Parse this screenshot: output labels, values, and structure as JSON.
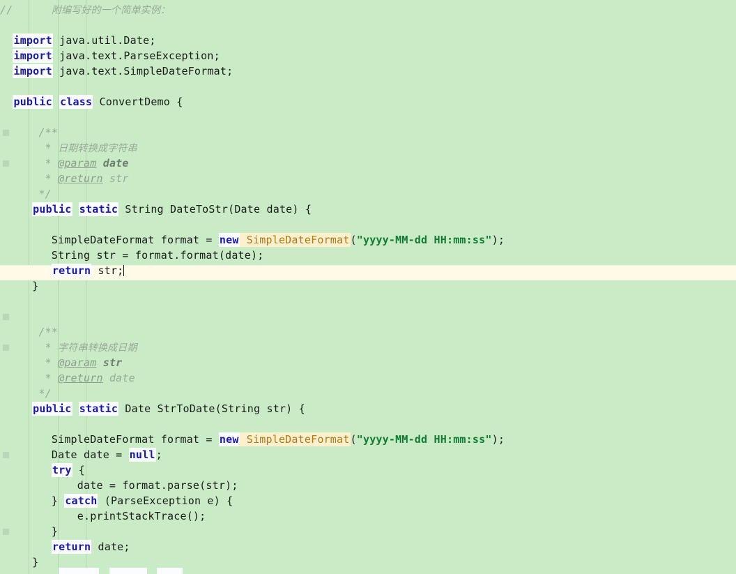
{
  "editor": {
    "language": "Java",
    "background_color": "#c9ecc6",
    "current_line_color": "#fffbe8",
    "keyword_color": "#1818b0",
    "string_color": "#127a32",
    "comment_color": "#9aa89a",
    "class_highlight_color": "#b07818",
    "class_highlight_bg": "#fdf0cd"
  },
  "header": {
    "comment_slashes": "//",
    "comment_text": "附编写好的一个简单实例："
  },
  "code": {
    "imports": [
      {
        "kw": "import",
        "rest": " java.util.Date;"
      },
      {
        "kw": "import",
        "rest": " java.text.ParseException;"
      },
      {
        "kw": "import",
        "rest": " java.text.SimpleDateFormat;"
      }
    ],
    "class_decl": {
      "kw1": "public",
      "kw2": "class",
      "name": " ConvertDemo {"
    },
    "javadoc1": {
      "open": "/**",
      "desc_star": "* ",
      "desc": "日期转换成字符串",
      "param_star": "* ",
      "param_tag": "@param",
      "param_name": " date",
      "return_star": "* ",
      "return_tag": "@return",
      "return_name": " str",
      "close": "*/"
    },
    "method1": {
      "kw1": "public",
      "kw2": "static",
      "sig": " String DateToStr(Date date) {",
      "body_line1_pre": "SimpleDateFormat format = ",
      "body_line1_kw": "new",
      "body_line1_cls": " SimpleDateFormat",
      "body_line1_open": "(",
      "body_line1_str": "\"yyyy-MM-dd HH:mm:ss\"",
      "body_line1_close": ");",
      "body_line2": "String str = format.format(date);",
      "body_line3_kw": "return",
      "body_line3_rest": " str;",
      "close_brace": "}"
    },
    "javadoc2": {
      "open": "/**",
      "desc_star": "* ",
      "desc": "字符串转换成日期",
      "param_star": "* ",
      "param_tag": "@param",
      "param_name": " str",
      "return_star": "* ",
      "return_tag": "@return",
      "return_name": " date",
      "close": "*/"
    },
    "method2": {
      "kw1": "public",
      "kw2": "static",
      "sig": " Date StrToDate(String str) {",
      "body_line1_pre": "SimpleDateFormat format = ",
      "body_line1_kw": "new",
      "body_line1_cls": " SimpleDateFormat",
      "body_line1_open": "(",
      "body_line1_str": "\"yyyy-MM-dd HH:mm:ss\"",
      "body_line1_close": ");",
      "body_line2_pre": "Date date = ",
      "body_line2_kw": "null",
      "body_line2_post": ";",
      "try_kw": "try",
      "try_brace": " {",
      "try_body": "date = format.parse(str);",
      "catch_close": "} ",
      "catch_kw": "catch",
      "catch_rest": " (ParseException e) {",
      "catch_body": "e.printStackTrace();",
      "catch_end": "}",
      "return_kw": "return",
      "return_rest": " date;",
      "close_brace": "}"
    }
  },
  "cursor": {
    "on_line": "return str;",
    "visible": true
  }
}
